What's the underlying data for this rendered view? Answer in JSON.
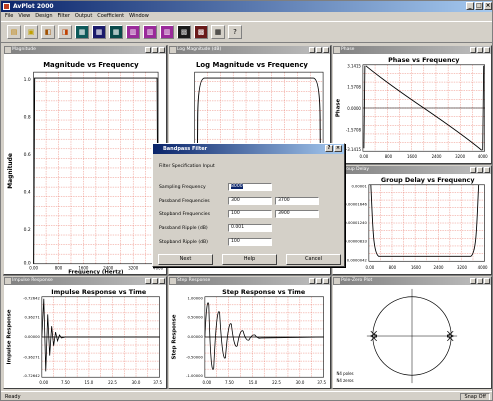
{
  "app": {
    "title": "AvPlot 2000"
  },
  "menu": [
    "File",
    "View",
    "Design",
    "Filter",
    "Output",
    "Coefficient",
    "Window"
  ],
  "toolbar_icons": [
    "new-icon",
    "open-icon",
    "save-icon",
    "print-icon",
    "filter-design-icon",
    "impulse-icon",
    "step-icon",
    "window-icon",
    "magnitude-icon",
    "phase-icon",
    "group-delay-icon",
    "tile-icon",
    "grid-icon",
    "help-icon"
  ],
  "windows": {
    "magnitude": {
      "title": "Magnitude",
      "chart_title": "Magnitude vs Frequency",
      "xlabel": "Frequency (Hertz)",
      "ylabel": "Magnitude",
      "yticks": [
        "1.0",
        "0.8",
        "0.6",
        "0.4",
        "0.2",
        "0.0"
      ],
      "xticks": [
        "0.00",
        "800",
        "1600",
        "2400",
        "3200",
        "4000"
      ]
    },
    "logmag": {
      "title": "Log Magnitude (dB)",
      "chart_title": "Log Magnitude vs Frequency"
    },
    "phase": {
      "title": "Phase",
      "chart_title": "Phase vs Frequency",
      "ylabel": "Phase",
      "yticks": [
        "3.1415",
        "1.5708",
        "0.0000",
        "-1.5708",
        "-3.1415"
      ],
      "xticks": [
        "0.00",
        "800",
        "1600",
        "2400",
        "3200",
        "4000"
      ]
    },
    "group_delay": {
      "title": "Group Delay",
      "chart_title": "Group Delay vs Frequency",
      "yticks": [
        "0.00001",
        "0.00001646",
        "0.00001240",
        "0.00000833",
        "0.0000042"
      ],
      "xticks": [
        "0.00",
        "800",
        "1600",
        "2400",
        "3200",
        "4000"
      ]
    },
    "impulse": {
      "title": "Impulse Response",
      "chart_title": "Impulse Response vs Time",
      "ylabel": "Impulse Response",
      "yticks": [
        "-0.72642",
        "0.36271",
        "0.00000",
        "-0.36271",
        "-0.72642"
      ],
      "xticks": [
        "0.00",
        "7.50",
        "15.0",
        "22.5",
        "30.0",
        "37.5"
      ]
    },
    "step": {
      "title": "Step Response",
      "chart_title": "Step Response vs Time",
      "ylabel": "Step Response",
      "yticks": [
        "1.00000",
        "0.50000",
        "0.00000",
        "-0.50000",
        "-1.00000"
      ],
      "xticks": [
        "0.00",
        "7.50",
        "15.0",
        "22.5",
        "30.0",
        "37.5"
      ]
    },
    "polezero": {
      "title": "Pole-Zero Plot",
      "poles_label": "N4 poles",
      "zeros_label": "N4 zeros"
    }
  },
  "dialog": {
    "title": "Bandpass Filter",
    "section_label": "Filter Specification Input",
    "fields": [
      {
        "label": "Sampling Frequency",
        "value1": "8000",
        "value2": ""
      },
      {
        "label": "Passband Frequencies",
        "value1": "300",
        "value2": "3700"
      },
      {
        "label": "Stopband Frequencies",
        "value1": "100",
        "value2": "3900"
      },
      {
        "label": "Passband Ripple (dB)",
        "value1": "0.001",
        "value2": ""
      },
      {
        "label": "Stopband Ripple (dB)",
        "value1": "100",
        "value2": ""
      }
    ],
    "buttons": {
      "next": "Next",
      "help": "Help",
      "cancel": "Cancel"
    }
  },
  "status": {
    "left": "Ready",
    "right": "Snap Off"
  },
  "colors": {
    "grid": "#e87060",
    "curve": "#000000",
    "titlebar": "#0a246a"
  }
}
